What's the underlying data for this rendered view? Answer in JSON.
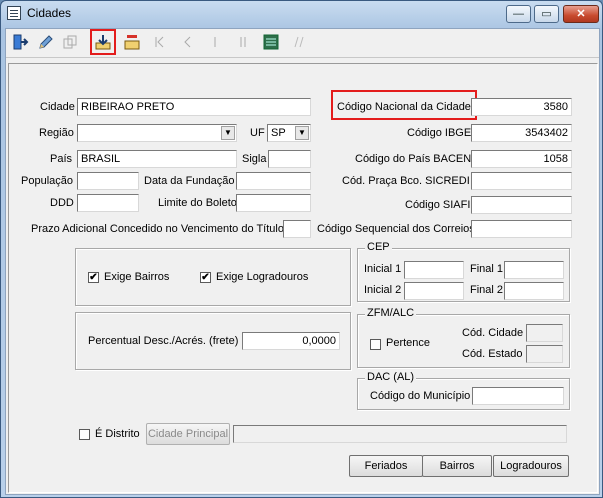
{
  "window": {
    "title": "Cidades",
    "close_glyph": "✕",
    "min_glyph": "—",
    "max_glyph": "▭"
  },
  "toolbar": {
    "items": [
      "exit-icon",
      "edit-icon",
      "duplicate-icon",
      "save-download-icon",
      "delete-folder-icon",
      "first-record-icon",
      "prev-record-icon",
      "next-record-icon",
      "last-record-icon",
      "list-view-icon",
      "disabled-tool-icon"
    ]
  },
  "form": {
    "cidade_label": "Cidade",
    "cidade_value": "RIBEIRAO PRETO",
    "regiao_label": "Região",
    "regiao_value": "",
    "uf_label": "UF",
    "uf_value": "SP",
    "pais_label": "País",
    "pais_value": "BRASIL",
    "sigla_label": "Sigla",
    "sigla_value": "",
    "populacao_label": "População",
    "populacao_value": "",
    "data_fundacao_label": "Data da Fundação",
    "data_fundacao_value": "",
    "ddd_label": "DDD",
    "ddd_value": "",
    "limite_boleto_label": "Limite do Boleto",
    "limite_boleto_value": "",
    "prazo_label": "Prazo Adicional Concedido no Vencimento do Título",
    "prazo_value": "",
    "codigo_nacional_label": "Código Nacional da Cidade",
    "codigo_nacional_value": "3580",
    "codigo_ibge_label": "Código IBGE",
    "codigo_ibge_value": "3543402",
    "codigo_pais_bacen_label": "Código do País BACEN",
    "codigo_pais_bacen_value": "1058",
    "cod_praca_label": "Cód. Praça Bco. SICREDI",
    "cod_praca_value": "",
    "codigo_siafi_label": "Código SIAFI",
    "codigo_siafi_value": "",
    "codigo_seq_correios_label": "Código Sequencial dos Correios",
    "codigo_seq_correios_value": ""
  },
  "checks": {
    "exige_bairros_label": "Exige Bairros",
    "exige_bairros_checked": true,
    "exige_logradouros_label": "Exige Logradouros",
    "exige_logradouros_checked": true,
    "mark": "✔"
  },
  "cep": {
    "title": "CEP",
    "inicial1_label": "Inicial 1",
    "final1_label": "Final 1",
    "inicial2_label": "Inicial 2",
    "final2_label": "Final 2"
  },
  "percentual": {
    "label": "Percentual Desc./Acrés. (frete)",
    "value": "0,0000"
  },
  "zfm": {
    "title": "ZFM/ALC",
    "pertence_label": "Pertence",
    "pertence_checked": false,
    "cod_cidade_label": "Cód. Cidade",
    "cod_estado_label": "Cód. Estado"
  },
  "dac": {
    "title": "DAC (AL)",
    "codigo_municipio_label": "Código do Município",
    "codigo_municipio_value": ""
  },
  "distrito": {
    "label": "É Distrito",
    "checked": false,
    "cidade_principal_button": "Cidade Principal",
    "cidade_principal_value": ""
  },
  "buttons": {
    "feriados": "Feriados",
    "bairros": "Bairros",
    "logradouros": "Logradouros"
  }
}
